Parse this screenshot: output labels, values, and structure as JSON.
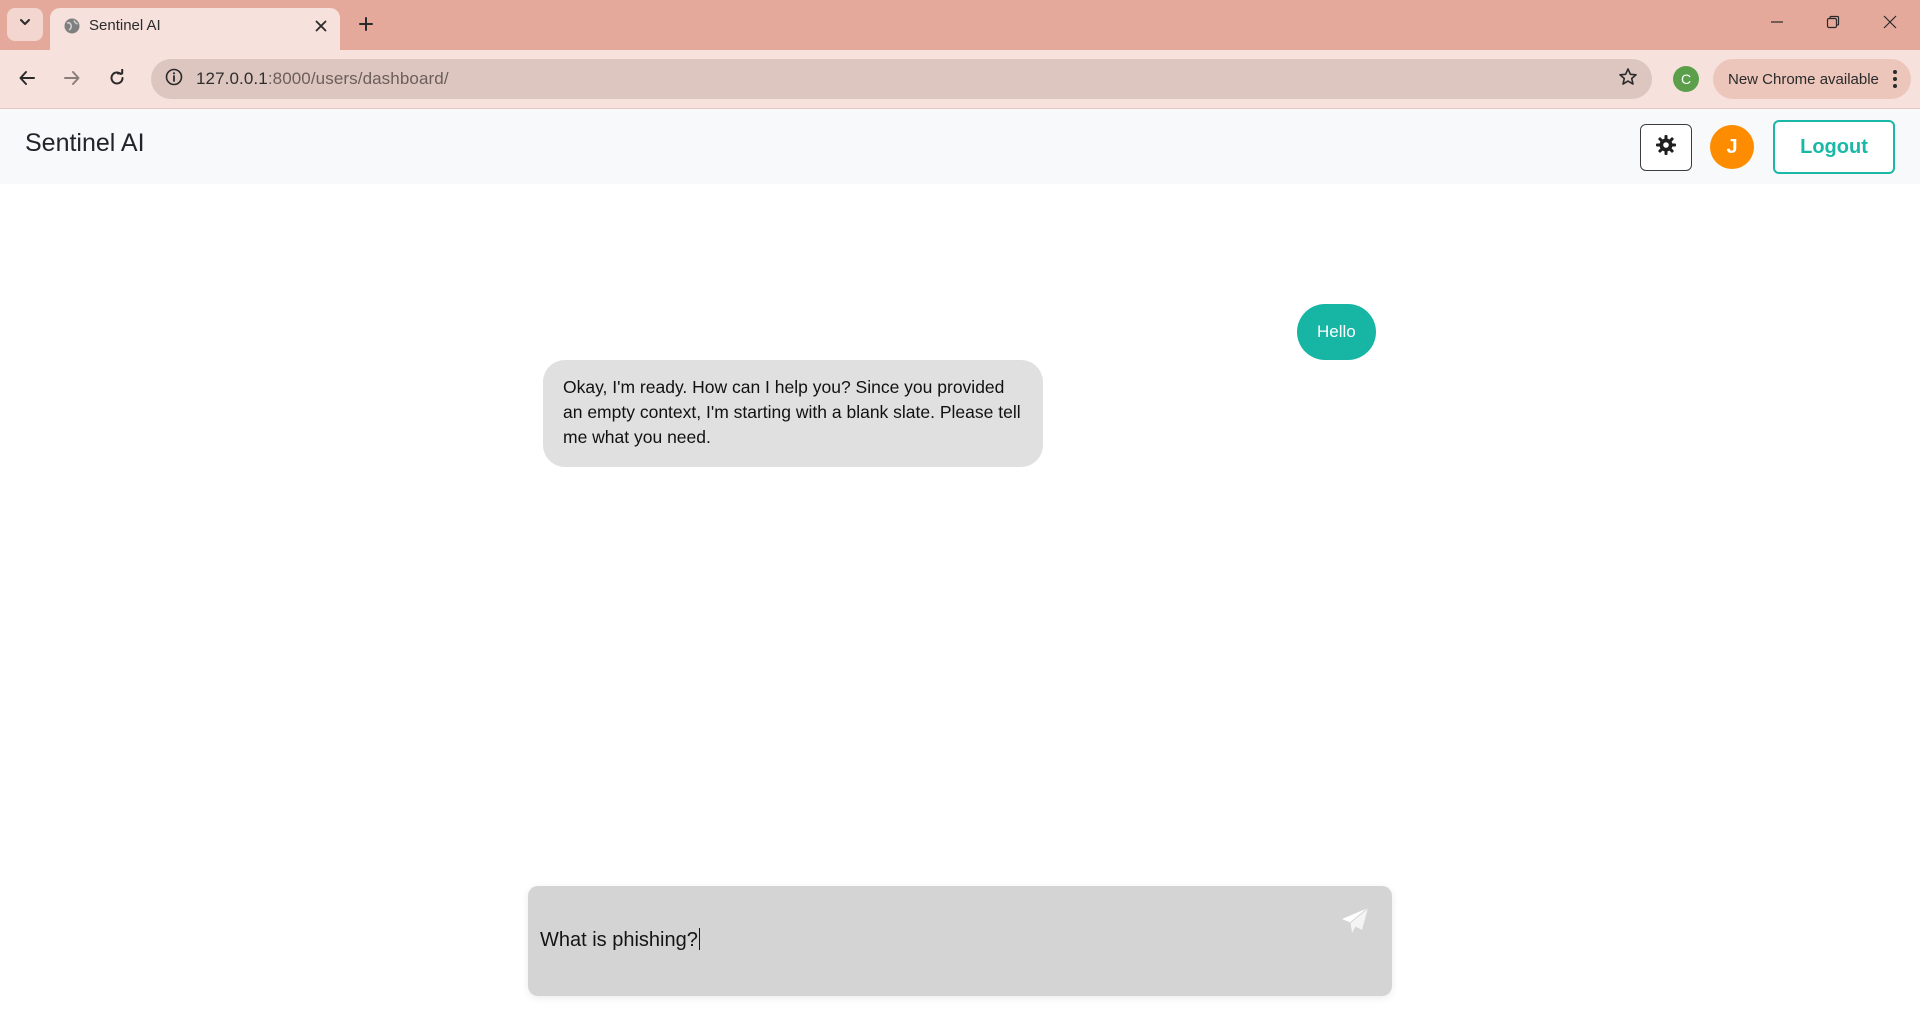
{
  "browser": {
    "tab": {
      "title": "Sentinel AI"
    },
    "address": {
      "host": "127.0.0.1",
      "port": ":8000",
      "path": "/users/dashboard/"
    },
    "profile_initial": "C",
    "update_label": "New Chrome available"
  },
  "app": {
    "brand": "Sentinel AI",
    "avatar_initial": "J",
    "logout_label": "Logout",
    "accent_color": "#1ab8a6",
    "avatar_color": "#fd8c00"
  },
  "chat": {
    "messages": [
      {
        "role": "user",
        "text": "Hello"
      },
      {
        "role": "assistant",
        "text": "Okay, I'm ready. How can I help you? Since you provided an empty context, I'm starting with a blank slate. Please tell me what you need."
      }
    ],
    "input_value": "What is phishing?"
  },
  "icons": {
    "tab_search": "chevron-down-icon",
    "favicon": "globe-icon",
    "tab_close": "close-icon",
    "new_tab": "plus-icon",
    "back": "arrow-left-icon",
    "forward": "arrow-right-icon",
    "reload": "reload-icon",
    "site_info": "info-icon",
    "bookmark": "star-icon",
    "theme": "gear-icon",
    "send": "paper-plane-icon",
    "menu": "kebab-icon"
  }
}
